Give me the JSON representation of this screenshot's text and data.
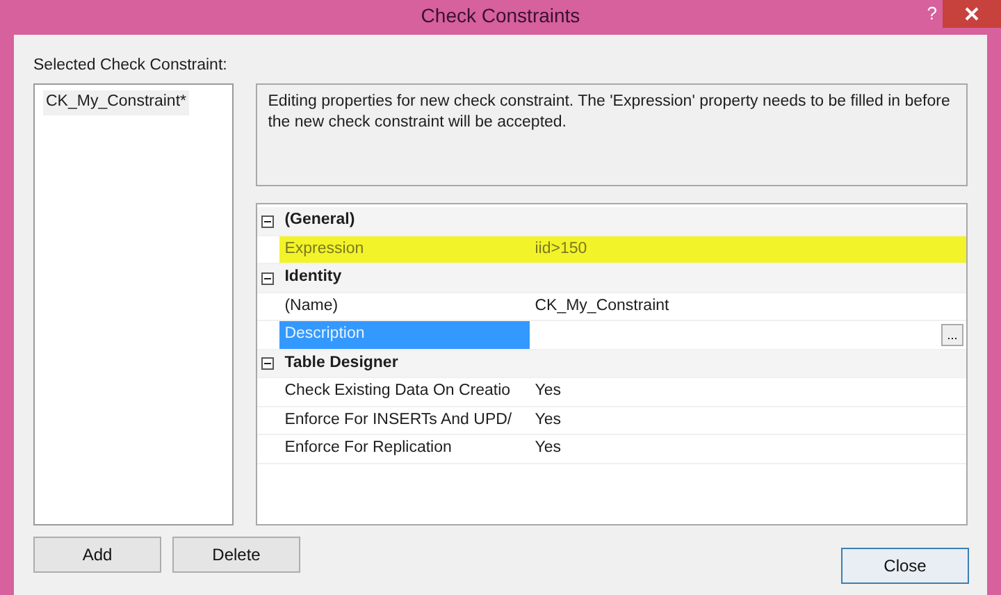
{
  "window": {
    "title": "Check Constraints",
    "help": "?"
  },
  "selected_label": "Selected Check Constraint:",
  "constraints": [
    {
      "name": "CK_My_Constraint*",
      "selected": true
    }
  ],
  "message": "Editing properties for new check constraint.  The 'Expression' property needs to be filled in before the new check constraint will be accepted.",
  "properties": [
    {
      "category": "(General)",
      "expanded": true,
      "items": [
        {
          "name": "Expression",
          "value": "iid>150",
          "selected": false,
          "highlighted": true
        }
      ]
    },
    {
      "category": "Identity",
      "expanded": true,
      "items": [
        {
          "name": "(Name)",
          "value": "CK_My_Constraint",
          "selected": false,
          "highlighted": false
        },
        {
          "name": "Description",
          "value": "",
          "button": "...",
          "selected": true,
          "highlighted": false
        }
      ]
    },
    {
      "category": "Table Designer",
      "expanded": true,
      "items": [
        {
          "name": "Check Existing Data On Creatio",
          "value": "Yes",
          "selected": false,
          "highlighted": false
        },
        {
          "name": "Enforce For INSERTs And UPD/",
          "value": "Yes",
          "selected": false,
          "highlighted": false
        },
        {
          "name": "Enforce For Replication",
          "value": "Yes",
          "selected": false,
          "highlighted": false
        }
      ]
    }
  ],
  "buttons": {
    "add": "Add",
    "delete": "Delete",
    "close": "Close"
  }
}
